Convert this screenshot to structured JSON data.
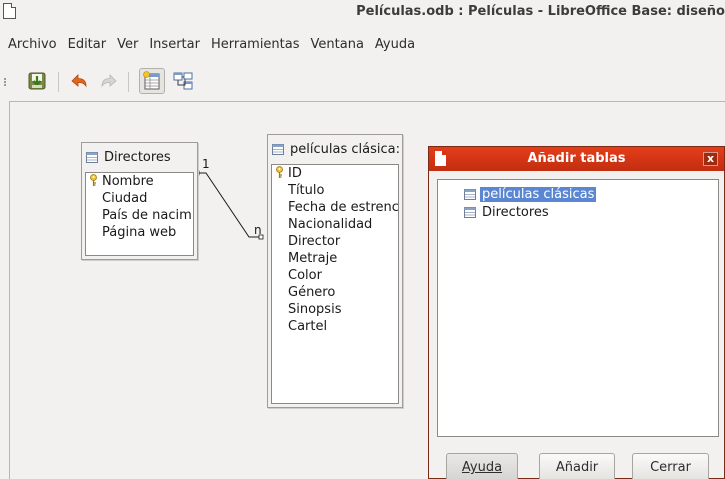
{
  "window": {
    "title": "Películas.odb : Películas - LibreOffice Base: diseño"
  },
  "menubar": {
    "items": [
      "Archivo",
      "Editar",
      "Ver",
      "Insertar",
      "Herramientas",
      "Ventana",
      "Ayuda"
    ]
  },
  "toolbar": {
    "buttons": [
      "save-icon",
      "undo-icon",
      "redo-icon",
      "add-tables-icon",
      "new-relation-icon"
    ]
  },
  "tables": {
    "directores": {
      "title": "Directores",
      "fields": [
        "Nombre",
        "Ciudad",
        "País de nacim",
        "Página web"
      ]
    },
    "peliculas": {
      "title": "películas clásica:",
      "fields": [
        "ID",
        "Título",
        "Fecha de estrenc",
        "Nacionalidad",
        "Director",
        "Metraje",
        "Color",
        "Género",
        "Sinopsis",
        "Cartel"
      ]
    }
  },
  "relation": {
    "left_cardinality": "1",
    "right_cardinality": "n"
  },
  "dialog": {
    "title": "Añadir tablas",
    "close_label": "x",
    "tables": [
      "películas clásicas",
      "Directores"
    ],
    "selected_index": 0,
    "buttons": {
      "help": "Ayuda",
      "add": "Añadir",
      "close": "Cerrar"
    }
  },
  "colors": {
    "dialog_title_bar": "#d43512",
    "selection": "#5b87d2",
    "background": "#f2f1f0"
  }
}
